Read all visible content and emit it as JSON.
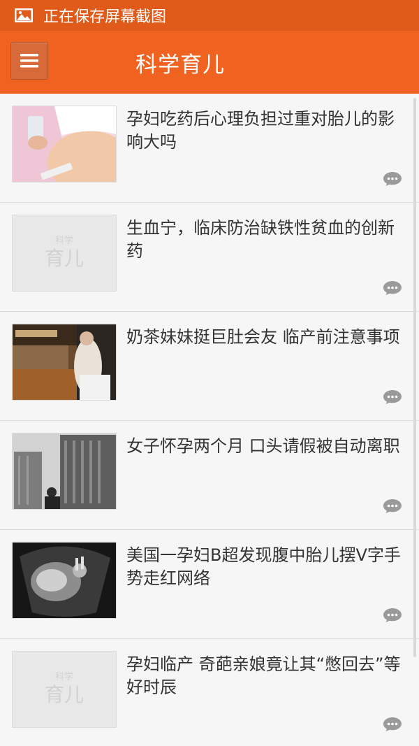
{
  "status": {
    "text": "正在保存屏幕截图",
    "icon": "image-icon"
  },
  "header": {
    "title": "科学育儿",
    "menu_icon": "hamburger-menu-icon",
    "background": "#f0621f"
  },
  "placeholder": {
    "small": "科学",
    "big": "育儿"
  },
  "articles": [
    {
      "title": "孕妇吃药后心理负担过重对胎儿的影响大吗",
      "thumb": "pregnant-belly-photo"
    },
    {
      "title": "生血宁，临床防治缺铁性贫血的创新药",
      "thumb": "placeholder"
    },
    {
      "title": "奶茶妹妹挺巨肚会友 临产前注意事项",
      "thumb": "restaurant-photo"
    },
    {
      "title": "女子怀孕两个月 口头请假被自动离职",
      "thumb": "buildings-photo"
    },
    {
      "title": "美国一孕妇B超发现腹中胎儿摆V字手势走红网络",
      "thumb": "ultrasound-photo"
    },
    {
      "title": "孕妇临产 奇葩亲娘竟让其“憋回去”等好时辰",
      "thumb": "placeholder"
    }
  ]
}
